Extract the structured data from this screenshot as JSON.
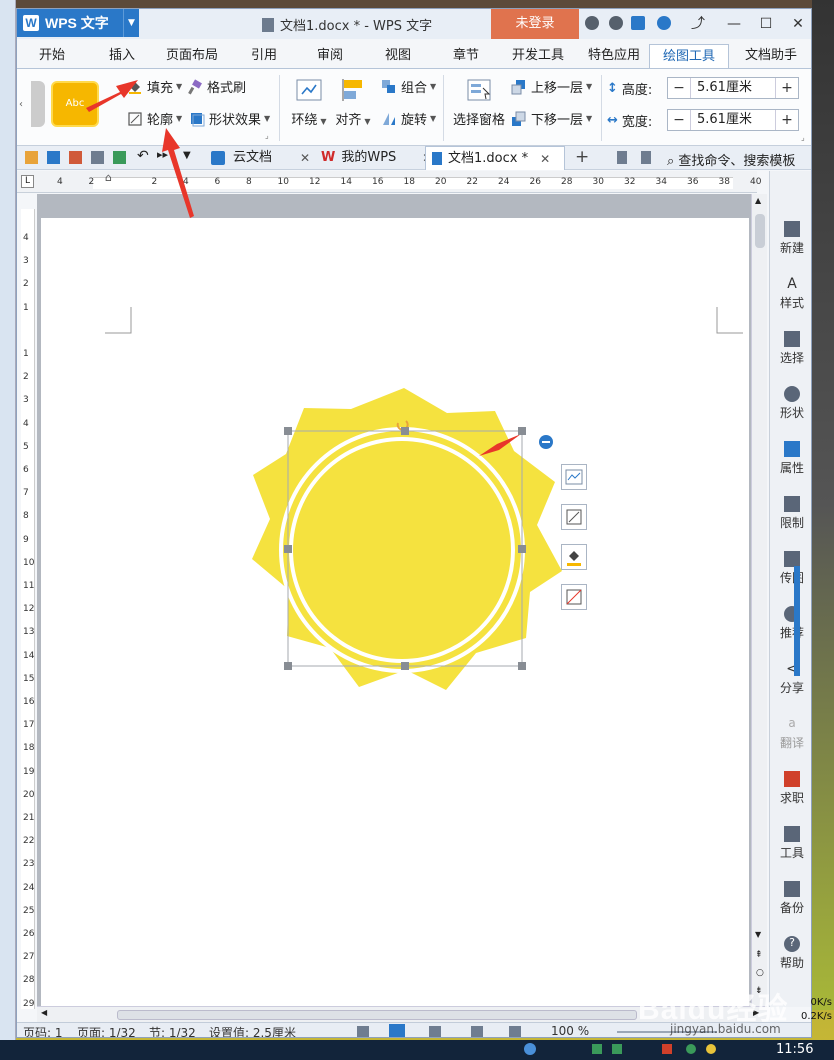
{
  "titlebar": {
    "app_name": "WPS 文字",
    "document_title": "文档1.docx * - WPS 文字",
    "login_label": "未登录"
  },
  "ribbon_tabs": [
    "开始",
    "插入",
    "页面布局",
    "引用",
    "审阅",
    "视图",
    "章节",
    "开发工具",
    "特色应用",
    "绘图工具",
    "文档助手"
  ],
  "active_tab": "绘图工具",
  "ribbon": {
    "style_swatch_label": "Abc",
    "fill_label": "填充",
    "format_painter_label": "格式刷",
    "outline_label": "轮廓",
    "shape_effect_label": "形状效果",
    "wrap_label": "环绕",
    "align_label": "对齐",
    "group_label": "组合",
    "rotate_label": "旋转",
    "selection_pane_label": "选择窗格",
    "bring_forward_label": "上移一层",
    "send_backward_label": "下移一层",
    "height_label": "高度:",
    "height_value": "5.61厘米",
    "width_label": "宽度:",
    "width_value": "5.61厘米",
    "minus": "−",
    "plus": "+"
  },
  "doc_tabs": {
    "cloud": "云文档",
    "mywps": "我的WPS",
    "current": "文档1.docx *",
    "search_placeholder": "查找命令、搜索模板"
  },
  "right_panel": [
    "新建",
    "样式",
    "选择",
    "形状",
    "属性",
    "限制",
    "传图",
    "推荐",
    "分享",
    "翻译",
    "求职",
    "工具",
    "备份",
    "帮助"
  ],
  "status": {
    "page_num": "页码: 1",
    "pages": "页面: 1/32",
    "section": "节: 1/32",
    "setting": "设置值: 2.5厘米",
    "zoom": "100 %"
  },
  "network": {
    "up": "0K/s",
    "down": "0.2K/s"
  },
  "clock": "11:56",
  "watermark": "Baidu经验",
  "watermark_url": "jingyan.baidu.com",
  "colors": {
    "accent": "#2a78c8",
    "sun": "#f5e23f",
    "login": "#e0734e",
    "arrow": "#e8362a"
  }
}
